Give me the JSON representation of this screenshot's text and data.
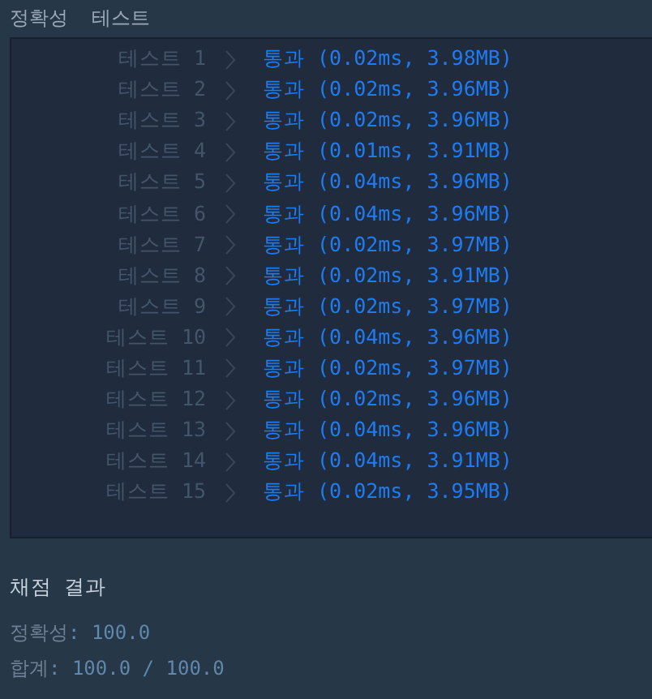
{
  "header": "정확성  테스트",
  "tests": [
    {
      "label": "테스트 1",
      "result": "통과 (0.02ms, 3.98MB)"
    },
    {
      "label": "테스트 2",
      "result": "통과 (0.02ms, 3.96MB)"
    },
    {
      "label": "테스트 3",
      "result": "통과 (0.02ms, 3.96MB)"
    },
    {
      "label": "테스트 4",
      "result": "통과 (0.01ms, 3.91MB)"
    },
    {
      "label": "테스트 5",
      "result": "통과 (0.04ms, 3.96MB)"
    },
    {
      "label": "테스트 6",
      "result": "통과 (0.04ms, 3.96MB)"
    },
    {
      "label": "테스트 7",
      "result": "통과 (0.02ms, 3.97MB)"
    },
    {
      "label": "테스트 8",
      "result": "통과 (0.02ms, 3.91MB)"
    },
    {
      "label": "테스트 9",
      "result": "통과 (0.02ms, 3.97MB)"
    },
    {
      "label": "테스트 10",
      "result": "통과 (0.04ms, 3.96MB)"
    },
    {
      "label": "테스트 11",
      "result": "통과 (0.02ms, 3.97MB)"
    },
    {
      "label": "테스트 12",
      "result": "통과 (0.02ms, 3.96MB)"
    },
    {
      "label": "테스트 13",
      "result": "통과 (0.04ms, 3.96MB)"
    },
    {
      "label": "테스트 14",
      "result": "통과 (0.04ms, 3.91MB)"
    },
    {
      "label": "테스트 15",
      "result": "통과 (0.02ms, 3.95MB)"
    }
  ],
  "summary": {
    "title": "채점 결과",
    "lines": [
      {
        "label": "정확성",
        "value": ": 100.0"
      },
      {
        "label": "합계",
        "value": ": 100.0 / 100.0"
      }
    ]
  }
}
